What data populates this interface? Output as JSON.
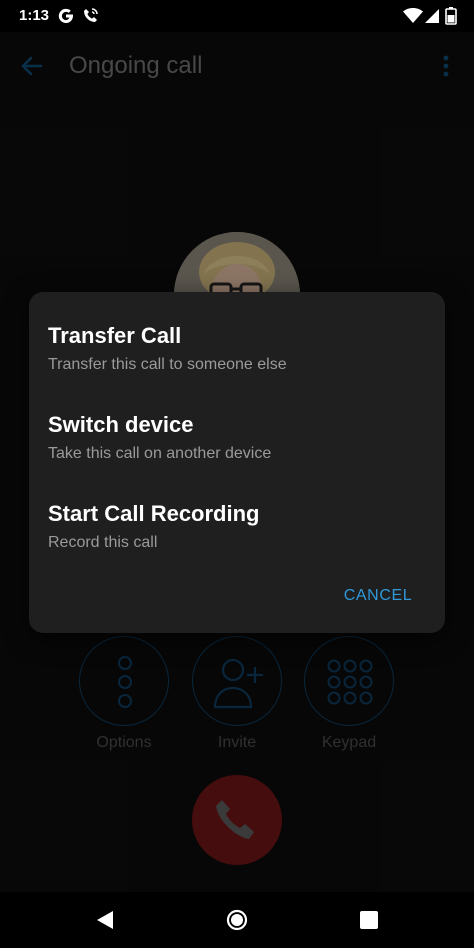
{
  "status_bar": {
    "time": "1:13",
    "icons": [
      "google-icon",
      "wifi-calling-icon",
      "wifi-icon",
      "signal-icon",
      "battery-icon"
    ]
  },
  "app_bar": {
    "title": "Ongoing call",
    "back_icon": "back-arrow-icon",
    "menu_icon": "more-vert-icon"
  },
  "call_actions": [
    {
      "label": "Options",
      "icon": "options-dots-icon"
    },
    {
      "label": "Invite",
      "icon": "add-person-icon"
    },
    {
      "label": "Keypad",
      "icon": "keypad-icon"
    }
  ],
  "hangup": {
    "icon": "phone-hangup-icon",
    "color": "#c0282a"
  },
  "dialog": {
    "items": [
      {
        "title": "Transfer Call",
        "subtitle": "Transfer this call to someone else"
      },
      {
        "title": "Switch device",
        "subtitle": "Take this call on another device"
      },
      {
        "title": "Start Call Recording",
        "subtitle": "Record this call"
      }
    ],
    "cancel_label": "CANCEL"
  },
  "nav_bar": {
    "icons": [
      "nav-back-icon",
      "nav-home-icon",
      "nav-recents-icon"
    ]
  },
  "colors": {
    "accent": "#2f98d8",
    "dialog_bg": "#1f1f1f",
    "hangup_red": "#c0282a"
  }
}
